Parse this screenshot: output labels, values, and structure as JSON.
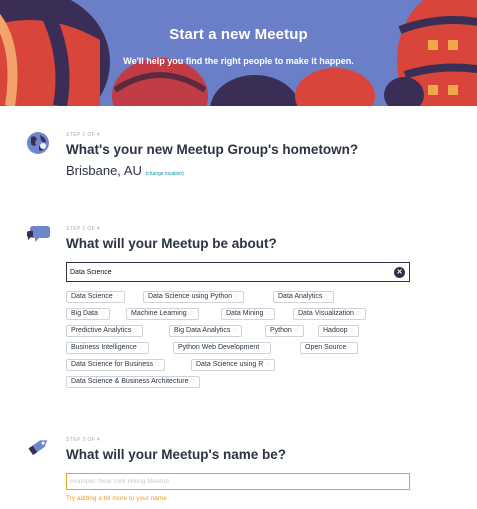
{
  "hero": {
    "title": "Start a new Meetup",
    "subtitle": "We'll help you find the right people to make it happen."
  },
  "step1": {
    "label": "STEP 1 OF 4",
    "title": "What's your new Meetup Group's hometown?",
    "location": "Brisbane, AU",
    "change_link": "(change location)",
    "icon": "globe-icon"
  },
  "step2": {
    "label": "STEP 2 OF 4",
    "title": "What will your Meetup be about?",
    "search_value": "Data Science",
    "icon": "speech-bubble-icon",
    "topics": [
      "Data Science",
      "Data Science using Python",
      "Data Analytics",
      "Big Data",
      "Machine Learning",
      "Data Mining",
      "Data Visualization",
      "Predictive Analytics",
      "Big Data Analytics",
      "Python",
      "Hadoop",
      "Business Intelligence",
      "Python Web Development",
      "Open Source",
      "Data Science for Business",
      "Data Science using R",
      "Data Science & Business Architecture"
    ]
  },
  "step3": {
    "label": "STEP 3 OF 4",
    "title": "What will your Meetup's name be?",
    "name_placeholder": "example: New York Hiking Meetup",
    "name_value": "",
    "hint": "Try adding a bit more to your name",
    "icon": "tag-icon"
  },
  "colors": {
    "hero": "#6b7fc8",
    "balloon_red": "#e0493a",
    "balloon_dark": "#3b2e56",
    "text": "#2b3345",
    "link": "#0098ab",
    "warning": "#f39c22",
    "icon_blue": "#6d87c9"
  }
}
